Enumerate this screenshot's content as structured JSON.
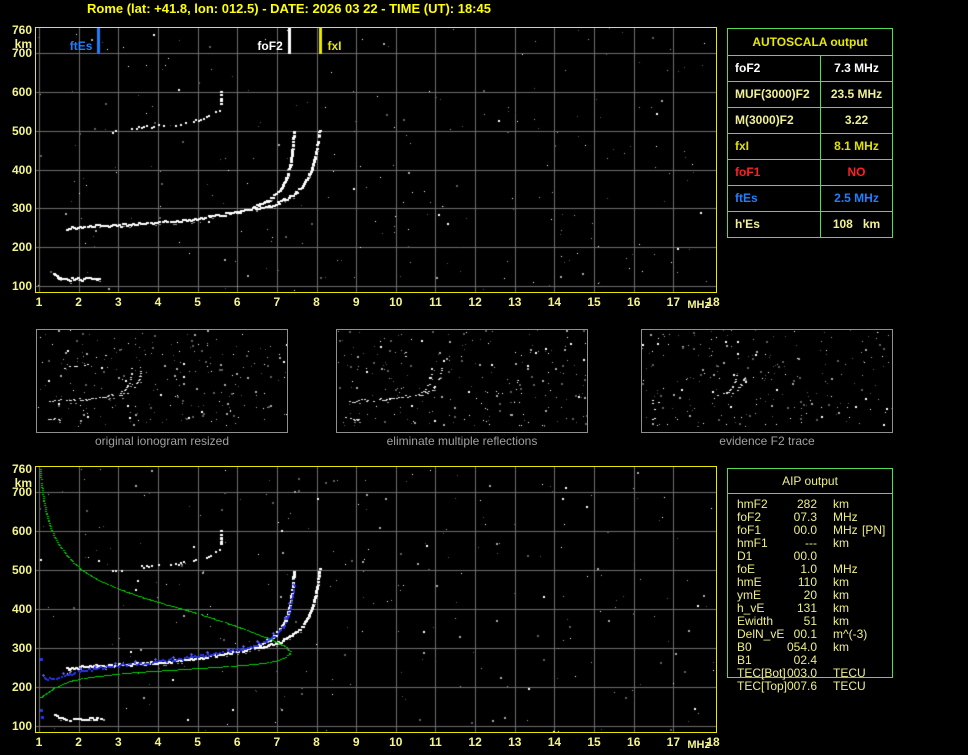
{
  "title": "Rome (lat: +41.8, lon: 012.5) - DATE: 2026 03 22 - TIME (UT): 18:45",
  "colors": {
    "background": "#000000",
    "frame_yellow": "#e8e800",
    "grid": "#6e6e6e",
    "axis_text": "#f5f58a",
    "table_green": "#55dd55",
    "khaki_text": "#eeee88",
    "trace_white": "#ffffff",
    "profile_green": "#00cc00",
    "trace_blue": "#2a35e8",
    "marker_blue": "#1f7fff",
    "alert_red": "#ff2020",
    "panel_border": "#909090",
    "caption_gray": "#a0a0a0"
  },
  "axes": {
    "x_ticks": [
      "1",
      "2",
      "3",
      "4",
      "5",
      "6",
      "7",
      "8",
      "9",
      "10",
      "11",
      "12",
      "13",
      "14",
      "15",
      "16",
      "17",
      "18"
    ],
    "x_unit": "MHz",
    "y_ticks": [
      "760",
      "700",
      "600",
      "500",
      "400",
      "300",
      "200",
      "100"
    ],
    "y_unit": "km",
    "x_range": [
      1,
      18
    ],
    "y_range": [
      100,
      760
    ]
  },
  "autoscala_table": {
    "header": "AUTOSCALA output",
    "rows": [
      {
        "label": "foF2",
        "value": "7.3 MHz",
        "color": "#ffffff"
      },
      {
        "label": "MUF(3000)F2",
        "value": "23.5 MHz",
        "color": "#f0f096"
      },
      {
        "label": "M(3000)F2",
        "value": "3.22",
        "color": "#f0f096"
      },
      {
        "label": "fxI",
        "value": "8.1 MHz",
        "color": "#e0e000"
      },
      {
        "label": "foF1",
        "value": "NO",
        "color": "#ff2020"
      },
      {
        "label": "ftEs",
        "value": "2.5 MHz",
        "color": "#1f7fff"
      },
      {
        "label": "h'Es",
        "value": "108   km",
        "color": "#f0f096"
      }
    ]
  },
  "aip_table": {
    "header": "AIP output",
    "rows": [
      {
        "label": "hmF2",
        "value": "282",
        "unit": "km",
        "extra": ""
      },
      {
        "label": "foF2",
        "value": "07.3",
        "unit": "MHz",
        "extra": ""
      },
      {
        "label": "foF1",
        "value": "00.0",
        "unit": "MHz",
        "extra": "[PN]"
      },
      {
        "label": "hmF1",
        "value": "---",
        "unit": "km",
        "extra": ""
      },
      {
        "label": "D1",
        "value": "00.0",
        "unit": "",
        "extra": ""
      },
      {
        "label": "foE",
        "value": "1.0",
        "unit": "MHz",
        "extra": ""
      },
      {
        "label": "hmE",
        "value": "110",
        "unit": "km",
        "extra": ""
      },
      {
        "label": "ymE",
        "value": "20",
        "unit": "km",
        "extra": ""
      },
      {
        "label": "h_vE",
        "value": "131",
        "unit": "km",
        "extra": ""
      },
      {
        "label": "Ewidth",
        "value": "51",
        "unit": "km",
        "extra": ""
      },
      {
        "label": "DelN_vE",
        "value": "00.1",
        "unit": "m^(-3)",
        "extra": ""
      },
      {
        "label": "B0",
        "value": "054.0",
        "unit": "km",
        "extra": ""
      },
      {
        "label": "B1",
        "value": "02.4",
        "unit": "",
        "extra": ""
      },
      {
        "label": "TEC[Bot]",
        "value": "003.0",
        "unit": "TECU",
        "extra": ""
      },
      {
        "label": "TEC[Top]",
        "value": "007.6",
        "unit": "TECU",
        "extra": ""
      }
    ]
  },
  "panels": [
    {
      "caption": "original ionogram resized"
    },
    {
      "caption": "eliminate multiple reflections"
    },
    {
      "caption": "evidence F2 trace"
    }
  ],
  "chart_data": [
    {
      "type": "scatter",
      "name": "top-ionogram",
      "x_range": [
        1,
        18
      ],
      "y_range": [
        100,
        760
      ],
      "xlabel": "MHz",
      "ylabel": "km",
      "grid": true,
      "markers": [
        {
          "label": "ftEs",
          "f": 2.5,
          "color": "#1f7fff",
          "side": "left"
        },
        {
          "label": "foF2",
          "f": 7.3,
          "color": "#ffffff",
          "side": "left"
        },
        {
          "label": "fxI",
          "f": 8.1,
          "color": "#e8e800",
          "side": "right"
        }
      ],
      "series": [
        {
          "name": "E-trace",
          "style": "trace",
          "color": "#ffffff",
          "points": [
            [
              1.35,
              133
            ],
            [
              1.45,
              126
            ],
            [
              1.55,
              121
            ],
            [
              1.7,
              119
            ],
            [
              1.9,
              120
            ],
            [
              2.1,
              119
            ],
            [
              2.3,
              121
            ],
            [
              2.45,
              120
            ],
            [
              2.6,
              120
            ]
          ]
        },
        {
          "name": "F-trace-ordinary",
          "style": "trace",
          "color": "#ffffff",
          "points": [
            [
              1.68,
              248
            ],
            [
              1.85,
              252
            ],
            [
              2.1,
              254
            ],
            [
              2.4,
              256
            ],
            [
              2.7,
              257
            ],
            [
              3.0,
              258
            ],
            [
              3.3,
              260
            ],
            [
              3.6,
              262
            ],
            [
              3.9,
              264
            ],
            [
              4.2,
              267
            ],
            [
              4.5,
              270
            ],
            [
              4.8,
              274
            ],
            [
              5.1,
              278
            ],
            [
              5.4,
              282
            ],
            [
              5.7,
              287
            ],
            [
              6.0,
              293
            ],
            [
              6.2,
              298
            ],
            [
              6.4,
              305
            ],
            [
              6.6,
              313
            ],
            [
              6.8,
              324
            ],
            [
              6.95,
              337
            ],
            [
              7.08,
              352
            ],
            [
              7.18,
              370
            ],
            [
              7.26,
              392
            ],
            [
              7.32,
              418
            ],
            [
              7.36,
              448
            ],
            [
              7.39,
              478
            ],
            [
              7.41,
              505
            ]
          ]
        },
        {
          "name": "F-trace-extraordinary",
          "style": "trace",
          "color": "#ffffff",
          "points": [
            [
              6.45,
              300
            ],
            [
              6.7,
              306
            ],
            [
              6.95,
              314
            ],
            [
              7.2,
              325
            ],
            [
              7.42,
              339
            ],
            [
              7.6,
              356
            ],
            [
              7.74,
              377
            ],
            [
              7.85,
              402
            ],
            [
              7.93,
              430
            ],
            [
              7.99,
              458
            ],
            [
              8.03,
              485
            ],
            [
              8.06,
              508
            ]
          ]
        },
        {
          "name": "second-hop-reflection",
          "style": "sparse",
          "color": "#ffffff",
          "points": [
            [
              2.78,
              498
            ],
            [
              3.0,
              503
            ],
            [
              3.25,
              506
            ],
            [
              3.5,
              509
            ],
            [
              3.75,
              512
            ],
            [
              4.0,
              514
            ],
            [
              4.25,
              517
            ],
            [
              4.5,
              519
            ],
            [
              4.75,
              523
            ],
            [
              5.0,
              528
            ],
            [
              5.2,
              535
            ],
            [
              5.45,
              548
            ],
            [
              5.6,
              556
            ]
          ]
        },
        {
          "name": "vertical-dash",
          "style": "trace",
          "color": "#ffffff",
          "points": [
            [
              5.56,
              600
            ],
            [
              5.56,
              568
            ]
          ]
        }
      ]
    },
    {
      "type": "scatter",
      "name": "bottom-ionogram",
      "x_range": [
        1,
        18
      ],
      "y_range": [
        100,
        760
      ],
      "xlabel": "MHz",
      "ylabel": "km",
      "grid": true,
      "series_from": 0,
      "series": [
        {
          "name": "electron-density-profile",
          "style": "dotline",
          "color": "#00cc00",
          "points": [
            [
              1.02,
              760
            ],
            [
              1.06,
              715
            ],
            [
              1.12,
              672
            ],
            [
              1.2,
              634
            ],
            [
              1.32,
              600
            ],
            [
              1.48,
              568
            ],
            [
              1.68,
              540
            ],
            [
              1.9,
              516
            ],
            [
              2.15,
              495
            ],
            [
              2.45,
              477
            ],
            [
              2.8,
              461
            ],
            [
              3.15,
              447
            ],
            [
              3.5,
              434
            ],
            [
              3.85,
              423
            ],
            [
              4.2,
              412
            ],
            [
              4.55,
              402
            ],
            [
              4.9,
              392
            ],
            [
              5.25,
              381
            ],
            [
              5.6,
              369
            ],
            [
              5.95,
              357
            ],
            [
              6.25,
              346
            ],
            [
              6.55,
              334
            ],
            [
              6.8,
              324
            ],
            [
              7.0,
              315
            ],
            [
              7.15,
              307
            ],
            [
              7.26,
              299
            ],
            [
              7.32,
              292
            ],
            [
              7.3,
              285
            ],
            [
              7.2,
              277
            ],
            [
              7.0,
              269
            ],
            [
              6.7,
              263
            ],
            [
              6.3,
              258
            ],
            [
              5.8,
              254
            ],
            [
              5.2,
              250
            ],
            [
              4.6,
              246
            ],
            [
              4.0,
              242
            ],
            [
              3.4,
              238
            ],
            [
              2.9,
              233
            ],
            [
              2.45,
              228
            ],
            [
              2.1,
              223
            ],
            [
              1.8,
              216
            ],
            [
              1.58,
              208
            ],
            [
              1.4,
              199
            ],
            [
              1.26,
              190
            ],
            [
              1.14,
              182
            ],
            [
              1.05,
              175
            ],
            [
              1.0,
              172
            ]
          ]
        },
        {
          "name": "autoscaled-blue-trace",
          "style": "bluetrace",
          "color": "#2a35e8",
          "points": [
            [
              1.12,
              226
            ],
            [
              1.25,
              223
            ],
            [
              1.4,
              224
            ],
            [
              1.6,
              230
            ],
            [
              1.85,
              238
            ],
            [
              2.1,
              244
            ],
            [
              2.4,
              249
            ],
            [
              2.7,
              253
            ],
            [
              3.0,
              257
            ],
            [
              3.3,
              260
            ],
            [
              3.6,
              263
            ],
            [
              3.9,
              266
            ],
            [
              4.2,
              270
            ],
            [
              4.5,
              274
            ],
            [
              4.8,
              278
            ],
            [
              5.1,
              282
            ],
            [
              5.4,
              287
            ],
            [
              5.7,
              292
            ],
            [
              5.95,
              297
            ],
            [
              6.2,
              302
            ],
            [
              6.45,
              309
            ],
            [
              6.65,
              317
            ],
            [
              6.85,
              327
            ],
            [
              7.0,
              339
            ],
            [
              7.12,
              353
            ],
            [
              7.22,
              370
            ],
            [
              7.29,
              390
            ],
            [
              7.34,
              412
            ],
            [
              7.38,
              435
            ],
            [
              7.41,
              455
            ],
            [
              7.43,
              465
            ]
          ]
        },
        {
          "name": "blue-isolated-dots",
          "style": "dots",
          "color": "#2a35e8",
          "points": [
            [
              1.05,
              272
            ],
            [
              1.05,
              140
            ],
            [
              1.07,
              122
            ]
          ]
        }
      ]
    },
    {
      "type": "scatter",
      "name": "panel-original-resized",
      "x_range": [
        1,
        18
      ],
      "y_range": [
        100,
        760
      ],
      "grid": false,
      "series_from": 0,
      "noise": 430,
      "dim": true,
      "series": []
    },
    {
      "type": "scatter",
      "name": "panel-no-multiples",
      "x_range": [
        1,
        18
      ],
      "y_range": [
        100,
        760
      ],
      "grid": false,
      "series_from": 0,
      "exclude": [
        "second-hop-reflection"
      ],
      "noise": 390,
      "dim": true,
      "series": []
    },
    {
      "type": "scatter",
      "name": "panel-f2-evidence",
      "x_range": [
        1,
        18
      ],
      "y_range": [
        100,
        760
      ],
      "grid": false,
      "noise": 130,
      "dim": true,
      "series": [
        {
          "name": "F2-cusp-o",
          "style": "trace",
          "color": "#ffffff",
          "points": [
            [
              6.0,
              293
            ],
            [
              6.2,
              298
            ],
            [
              6.4,
              305
            ],
            [
              6.6,
              313
            ],
            [
              6.8,
              324
            ],
            [
              6.95,
              337
            ],
            [
              7.08,
              352
            ],
            [
              7.18,
              370
            ],
            [
              7.26,
              392
            ],
            [
              7.32,
              418
            ],
            [
              7.36,
              448
            ]
          ]
        },
        {
          "name": "F2-cusp-x",
          "style": "trace",
          "color": "#ffffff",
          "points": [
            [
              6.7,
              306
            ],
            [
              6.95,
              314
            ],
            [
              7.2,
              325
            ],
            [
              7.42,
              339
            ],
            [
              7.6,
              356
            ],
            [
              7.74,
              377
            ],
            [
              7.85,
              402
            ],
            [
              7.93,
              430
            ]
          ]
        },
        {
          "name": "remnant-dots",
          "style": "sparse",
          "color": "#ffffff",
          "points": [
            [
              1.5,
              120
            ],
            [
              1.75,
              122
            ],
            [
              1.9,
              118
            ],
            [
              1.6,
              255
            ],
            [
              2.0,
              250
            ],
            [
              2.2,
              246
            ]
          ]
        }
      ]
    }
  ]
}
